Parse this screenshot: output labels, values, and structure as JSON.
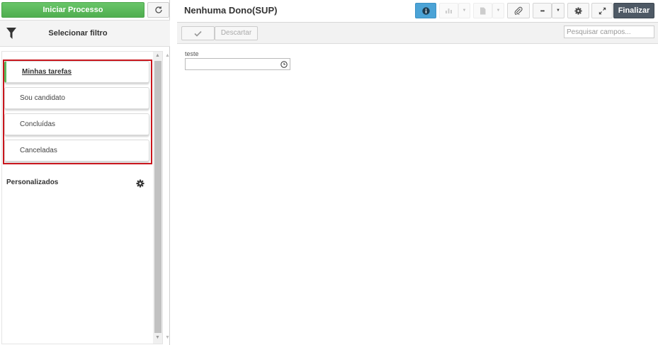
{
  "sidebar": {
    "start_button": "Iniciar Processo",
    "filter_title": "Selecionar filtro",
    "filters": [
      {
        "label": "Minhas tarefas",
        "active": true
      },
      {
        "label": "Sou candidato",
        "active": false
      },
      {
        "label": "Concluídas",
        "active": false
      },
      {
        "label": "Canceladas",
        "active": false
      }
    ],
    "custom_label": "Personalizados"
  },
  "header": {
    "title": "Nenhuma Dono(SUP)",
    "finish_button": "Finalizar",
    "more_glyph": "•••"
  },
  "actions": {
    "discard_label": "Descartar",
    "search_placeholder": "Pesquisar campos..."
  },
  "form": {
    "field_label": "teste",
    "field_value": ""
  },
  "icons": [
    "refresh-icon",
    "filter-icon",
    "gear-icon",
    "info-icon",
    "chart-icon",
    "document-icon",
    "paperclip-icon",
    "expand-icon",
    "check-icon",
    "clock-icon",
    "chevron-down-icon"
  ],
  "colors": {
    "start_green": "#5cb85c",
    "active_indicator": "#5cb85c",
    "highlight_border": "#c9161d",
    "info_blue": "#4ba3d6",
    "finish_dark": "#4e5965"
  }
}
